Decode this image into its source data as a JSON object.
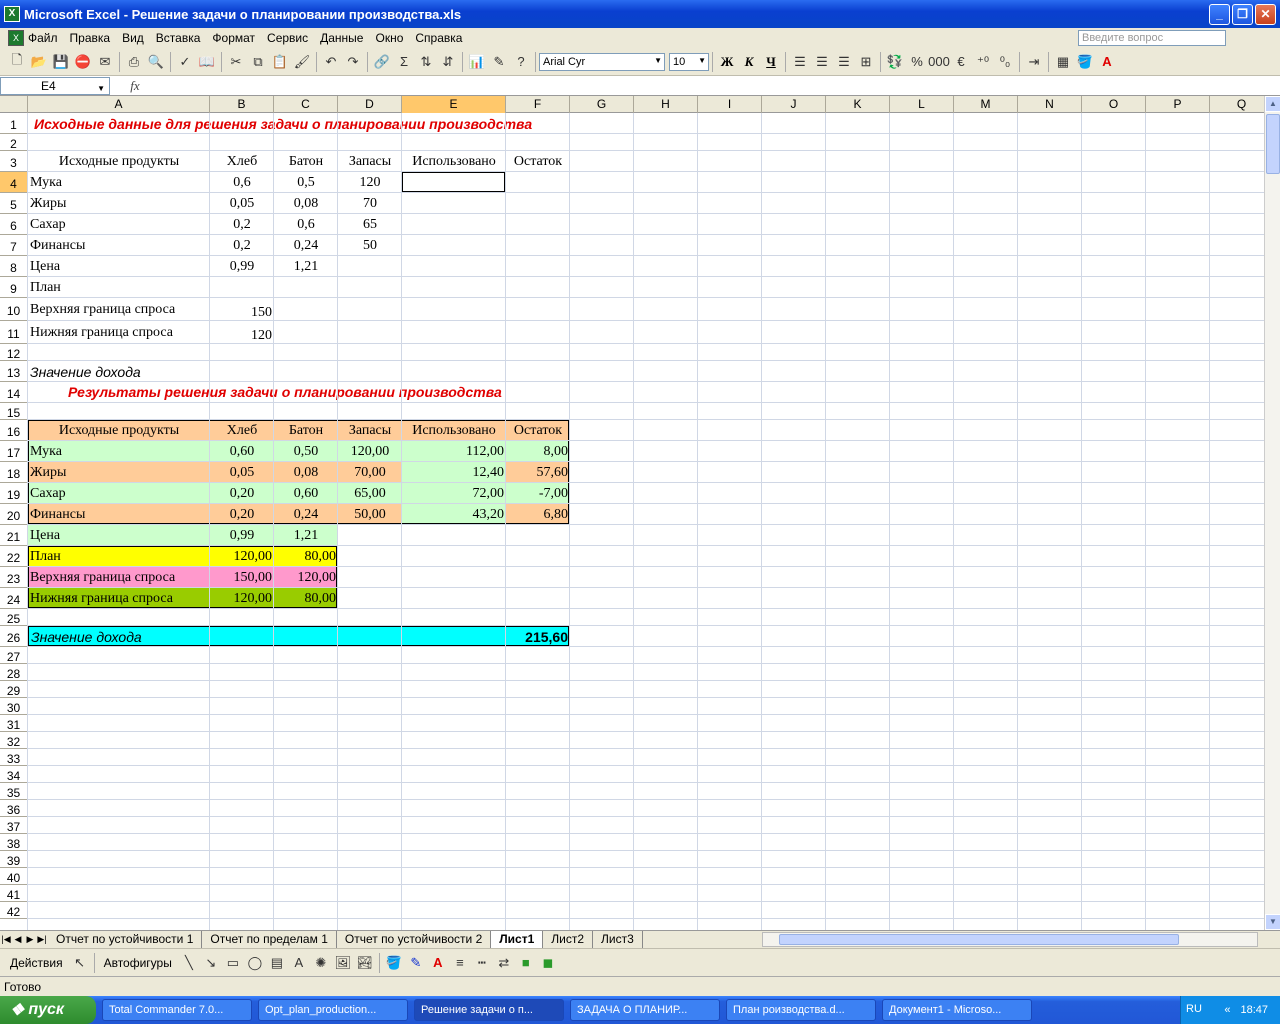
{
  "window": {
    "title": "Microsoft Excel - Решение задачи о планировании производства.xls"
  },
  "menu": [
    "Файл",
    "Правка",
    "Вид",
    "Вставка",
    "Формат",
    "Сервис",
    "Данные",
    "Окно",
    "Справка"
  ],
  "ask_placeholder": "Введите вопрос",
  "font": {
    "name": "Arial Cyr",
    "size": "10"
  },
  "format_buttons": {
    "bold": "Ж",
    "italic": "К",
    "underline": "Ч"
  },
  "namebox": "E4",
  "fx_label": "fx",
  "columns": [
    "A",
    "B",
    "C",
    "D",
    "E",
    "F",
    "G",
    "H",
    "I",
    "J",
    "K",
    "L",
    "M",
    "N",
    "O",
    "P",
    "Q"
  ],
  "selected_col": "E",
  "selected_row": 4,
  "rows": 42,
  "sheet": {
    "r1": "Исходные данные для  решения задачи о планировании производства",
    "header": [
      "Исходные продукты",
      "Хлеб",
      "Батон",
      "Запасы",
      "Использовано",
      "Остаток"
    ],
    "input_rows": [
      [
        "Мука",
        "0,6",
        "0,5",
        "120"
      ],
      [
        "Жиры",
        "0,05",
        "0,08",
        "70"
      ],
      [
        "Сахар",
        "0,2",
        "0,6",
        "65"
      ],
      [
        "Финансы",
        "0,2",
        "0,24",
        "50"
      ]
    ],
    "price": [
      "Цена",
      "0,99",
      "1,21"
    ],
    "plan": "План",
    "upper": [
      "Верхняя граница спроса",
      "150"
    ],
    "lower": [
      "Нижняя граница спроса",
      "120"
    ],
    "income_label": "Значение дохода",
    "r14": "Результаты решения задачи о планировании производства",
    "result_rows": [
      [
        "Мука",
        "0,60",
        "0,50",
        "120,00",
        "112,00",
        "8,00"
      ],
      [
        "Жиры",
        "0,05",
        "0,08",
        "70,00",
        "12,40",
        "57,60"
      ],
      [
        "Сахар",
        "0,20",
        "0,60",
        "65,00",
        "72,00",
        "-7,00"
      ],
      [
        "Финансы",
        "0,20",
        "0,24",
        "50,00",
        "43,20",
        "6,80"
      ]
    ],
    "r_price": [
      "Цена",
      "0,99",
      "1,21"
    ],
    "r_plan": [
      "План",
      "120,00",
      "80,00"
    ],
    "r_upper": [
      "Верхняя граница спроса",
      "150,00",
      "120,00"
    ],
    "r_lower": [
      "Нижняя граница спроса",
      "120,00",
      "80,00"
    ],
    "income_value": "215,60"
  },
  "tabs": [
    "Отчет по устойчивости 1",
    "Отчет по пределам 1",
    "Отчет по устойчивости 2",
    "Лист1",
    "Лист2",
    "Лист3"
  ],
  "active_tab": "Лист1",
  "drawbar": {
    "actions": "Действия",
    "autoshapes": "Автофигуры"
  },
  "status": "Готово",
  "taskbar": {
    "start": "пуск",
    "tasks": [
      "Total Commander 7.0...",
      "Opt_plan_production...",
      "Решение задачи о п...",
      "ЗАДАЧА О ПЛАНИР...",
      "План роизводства.d...",
      "Документ1 - Microso..."
    ],
    "active_task": 2,
    "lang": "RU",
    "time": "18:47"
  },
  "colors": {
    "green": "#ccffcc",
    "peach": "#ffcc99",
    "yellow": "#ffff00",
    "pink": "#ff99cc",
    "olive": "#99cc00",
    "cyan": "#00ffff",
    "title_red": "#e00000"
  }
}
